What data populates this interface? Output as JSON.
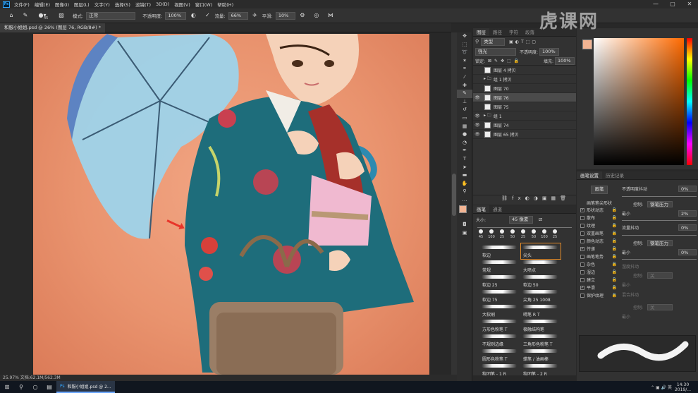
{
  "app": {
    "logo": "Ps"
  },
  "menu": [
    "文件(F)",
    "编辑(E)",
    "图像(I)",
    "图层(L)",
    "文字(Y)",
    "选择(S)",
    "滤镜(T)",
    "3D(D)",
    "视图(V)",
    "窗口(W)",
    "帮助(H)"
  ],
  "window_controls": [
    "—",
    "▢",
    "✕"
  ],
  "options": {
    "mode_label": "模式:",
    "mode_value": "正常",
    "opacity_label": "不透明度:",
    "opacity_value": "100%",
    "flow_label": "流量:",
    "flow_value": "66%",
    "smooth_label": "平滑:",
    "smooth_value": "10%",
    "brush_size": "45"
  },
  "document_tab": "和服小姐姐.psd @ 26% (图层 76, RGB/8#) *",
  "status": "25.97%    文档:62.1M/562.3M",
  "layers_panel": {
    "tabs": [
      "图层",
      "路径",
      "字符",
      "段落"
    ],
    "kind_label": "类型",
    "blend_mode": "强光",
    "opacity_label": "不透明度:",
    "opacity_value": "100%",
    "lock_label": "锁定:",
    "fill_label": "填充:",
    "fill_value": "100%",
    "layers": [
      {
        "name": "图层 4 拷贝",
        "visible": false,
        "selected": false,
        "folder": false
      },
      {
        "name": "组 1 拷贝",
        "visible": false,
        "selected": false,
        "folder": true
      },
      {
        "name": "图层 70",
        "visible": false,
        "selected": false,
        "folder": false
      },
      {
        "name": "图层 76",
        "visible": true,
        "selected": true,
        "folder": false
      },
      {
        "name": "图层 75",
        "visible": false,
        "selected": false,
        "folder": false
      },
      {
        "name": "组 1",
        "visible": true,
        "selected": false,
        "folder": true
      },
      {
        "name": "图层 74",
        "visible": true,
        "selected": false,
        "folder": false
      },
      {
        "name": "图层 65 拷贝",
        "visible": true,
        "selected": false,
        "folder": false
      }
    ]
  },
  "brush_panel": {
    "tabs": [
      "画笔",
      "通道"
    ],
    "size_label": "大小:",
    "size_value": "45 像素",
    "presets": [
      "45",
      "100",
      "25",
      "50",
      "25",
      "50",
      "100",
      "25"
    ],
    "brushes": [
      "软边",
      "尖头",
      "常规",
      "大喷点",
      "软边 25",
      "软边 50",
      "软边 75",
      "尖角 25 1008",
      "大软刷",
      "晴笔 R T",
      "方形色粉笔 T",
      "极融结构笔",
      "不规则边缘",
      "三角形色粉笔 T",
      "圆形色粉笔 T",
      "蜡笔 / 油画棒",
      "粒团笔 - 1 R",
      "粒团笔 - 2 R"
    ]
  },
  "brush_settings": {
    "tabs": [
      "画笔设置",
      "历史记录"
    ],
    "button": "画笔",
    "tip_label": "画笔笔尖形状",
    "options": [
      {
        "label": "形状动态",
        "checked": true
      },
      {
        "label": "散布",
        "checked": false
      },
      {
        "label": "纹理",
        "checked": false
      },
      {
        "label": "双重画笔",
        "checked": false
      },
      {
        "label": "颜色动态",
        "checked": false
      },
      {
        "label": "传递",
        "checked": true
      },
      {
        "label": "画笔笔势",
        "checked": false
      },
      {
        "label": "杂色",
        "checked": false
      },
      {
        "label": "湿边",
        "checked": false
      },
      {
        "label": "建立",
        "checked": false
      },
      {
        "label": "平滑",
        "checked": true
      },
      {
        "label": "保护纹理",
        "checked": false
      }
    ],
    "opacity_jitter_label": "不透明度抖动",
    "opacity_jitter_value": "0%",
    "control_label": "控制:",
    "control_value": "钢笔压力",
    "min_label": "最小",
    "min_value": "2%",
    "flow_jitter_label": "流量抖动",
    "flow_jitter_value": "0%",
    "control2_value": "钢笔压力",
    "min2_value": "0%",
    "wet_jitter_label": "湿度抖动",
    "control3_value": "关",
    "mix_jitter_label": "混合抖动",
    "control4_value": "关"
  },
  "watermark": "虎课网",
  "taskbar": {
    "app_label": "和服小姐姐.psd @ 2...",
    "time": "14:30",
    "date": "2019/..."
  },
  "colors": {
    "foreground": "#f2b493",
    "background": "#ffffff",
    "accent": "#e8352a"
  }
}
